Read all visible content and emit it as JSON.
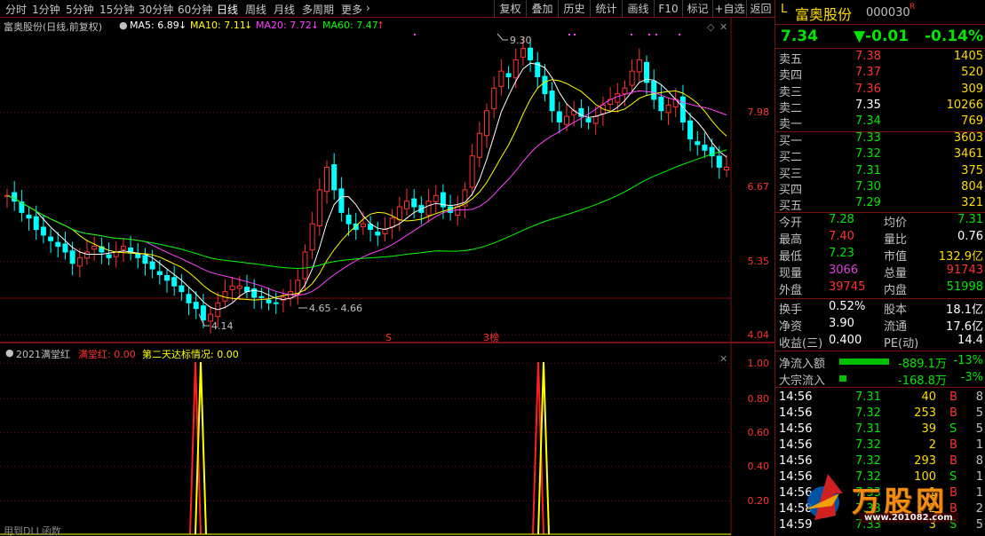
{
  "toolbar": {
    "left_items": [
      "分时",
      "1分钟",
      "5分钟",
      "15分钟",
      "30分钟",
      "60分钟",
      "日线",
      "周线",
      "月线",
      "多周期",
      "更多"
    ],
    "active_item": "日线",
    "right_items": [
      "复权",
      "叠加",
      "历史",
      "统计",
      "画线",
      "F10",
      "标记",
      "+自选",
      "返回"
    ]
  },
  "main_chart": {
    "title": "富奥股份(日线,前复权)",
    "ma5": "MA5: 6.89",
    "ma10": "MA10: 7.11",
    "ma20": "MA20: 7.72",
    "ma60": "MA60: 7.47",
    "y_labels": [
      "7.98",
      "6.67",
      "5.35",
      "4.04"
    ],
    "annotation_high": "9.30",
    "annotation_low": "4.14",
    "annotation_range": "4.65 - 4.66",
    "marker_s": "S",
    "marker_bang": "3榜"
  },
  "indicator": {
    "title": "2021满堂红",
    "line1": "满堂红: 0.00",
    "line2": "第二天达标情况: 0.00",
    "y_labels": [
      "1.00",
      "0.80",
      "0.60",
      "0.40",
      "0.20"
    ],
    "footer": "用到DLL函数"
  },
  "quote": {
    "prefix": "L",
    "name": "富奥股份",
    "code": "000030",
    "flag": "R",
    "price": "7.34",
    "change": "▼-0.01",
    "change_pct": "-0.14%",
    "asks": [
      {
        "label": "卖五",
        "price": "7.38",
        "vol": "1405"
      },
      {
        "label": "卖四",
        "price": "7.37",
        "vol": "520"
      },
      {
        "label": "卖三",
        "price": "7.36",
        "vol": "309"
      },
      {
        "label": "卖二",
        "price": "7.35",
        "vol": "10266"
      },
      {
        "label": "卖一",
        "price": "7.34",
        "vol": "769"
      }
    ],
    "bids": [
      {
        "label": "买一",
        "price": "7.33",
        "vol": "3603"
      },
      {
        "label": "买二",
        "price": "7.32",
        "vol": "3461"
      },
      {
        "label": "买三",
        "price": "7.31",
        "vol": "375"
      },
      {
        "label": "买四",
        "price": "7.30",
        "vol": "804"
      },
      {
        "label": "买五",
        "price": "7.29",
        "vol": "321"
      }
    ],
    "stats": [
      {
        "l1": "今开",
        "v1": "7.28",
        "l2": "均价",
        "v2": "7.31"
      },
      {
        "l1": "最高",
        "v1": "7.40",
        "l2": "量比",
        "v2": "0.76"
      },
      {
        "l1": "最低",
        "v1": "7.23",
        "l2": "市值",
        "v2": "132.9亿"
      },
      {
        "l1": "现量",
        "v1": "3066",
        "l2": "总量",
        "v2": "91743"
      },
      {
        "l1": "外盘",
        "v1": "39745",
        "l2": "内盘",
        "v2": "51998"
      }
    ],
    "stats2": [
      {
        "l1": "换手",
        "v1": "0.52%",
        "l2": "股本",
        "v2": "18.1亿"
      },
      {
        "l1": "净资",
        "v1": "3.90",
        "l2": "流通",
        "v2": "17.6亿"
      },
      {
        "l1": "收益(三)",
        "v1": "0.400",
        "l2": "PE(动)",
        "v2": "14.4"
      }
    ],
    "flows": [
      {
        "label": "净流入额",
        "value": "-889.1万",
        "pct": "-13%",
        "bar": 1.0
      },
      {
        "label": "大宗流入",
        "value": "-168.8万",
        "pct": "-3%",
        "bar": 0.14
      }
    ],
    "ticks": [
      {
        "time": "14:56",
        "price": "7.31",
        "vol": "40",
        "side": "B",
        "n": "8"
      },
      {
        "time": "14:56",
        "price": "7.32",
        "vol": "253",
        "side": "B",
        "n": "5"
      },
      {
        "time": "14:56",
        "price": "7.31",
        "vol": "39",
        "side": "S",
        "n": "5"
      },
      {
        "time": "14:56",
        "price": "7.32",
        "vol": "2",
        "side": "B",
        "n": "1"
      },
      {
        "time": "14:56",
        "price": "7.32",
        "vol": "293",
        "side": "B",
        "n": "8"
      },
      {
        "time": "14:56",
        "price": "7.32",
        "vol": "100",
        "side": "S",
        "n": "1"
      },
      {
        "time": "14:56",
        "price": "7.33",
        "vol": "1",
        "side": "B",
        "n": "1"
      },
      {
        "time": "14:58",
        "price": "7.33",
        "vol": "2",
        "side": "B",
        "n": "2"
      },
      {
        "time": "14:59",
        "price": "7.33",
        "vol": "3",
        "side": "S",
        "n": "5"
      }
    ]
  },
  "watermark": {
    "text": "万股网",
    "url": "www.201082.com"
  },
  "colors": {
    "up": "#ff3232",
    "down": "#00ffff",
    "ma5": "#ffffff",
    "ma10": "#ffff00",
    "ma20": "#ff40ff",
    "ma60": "#00ff00",
    "frame": "#7a1010"
  }
}
